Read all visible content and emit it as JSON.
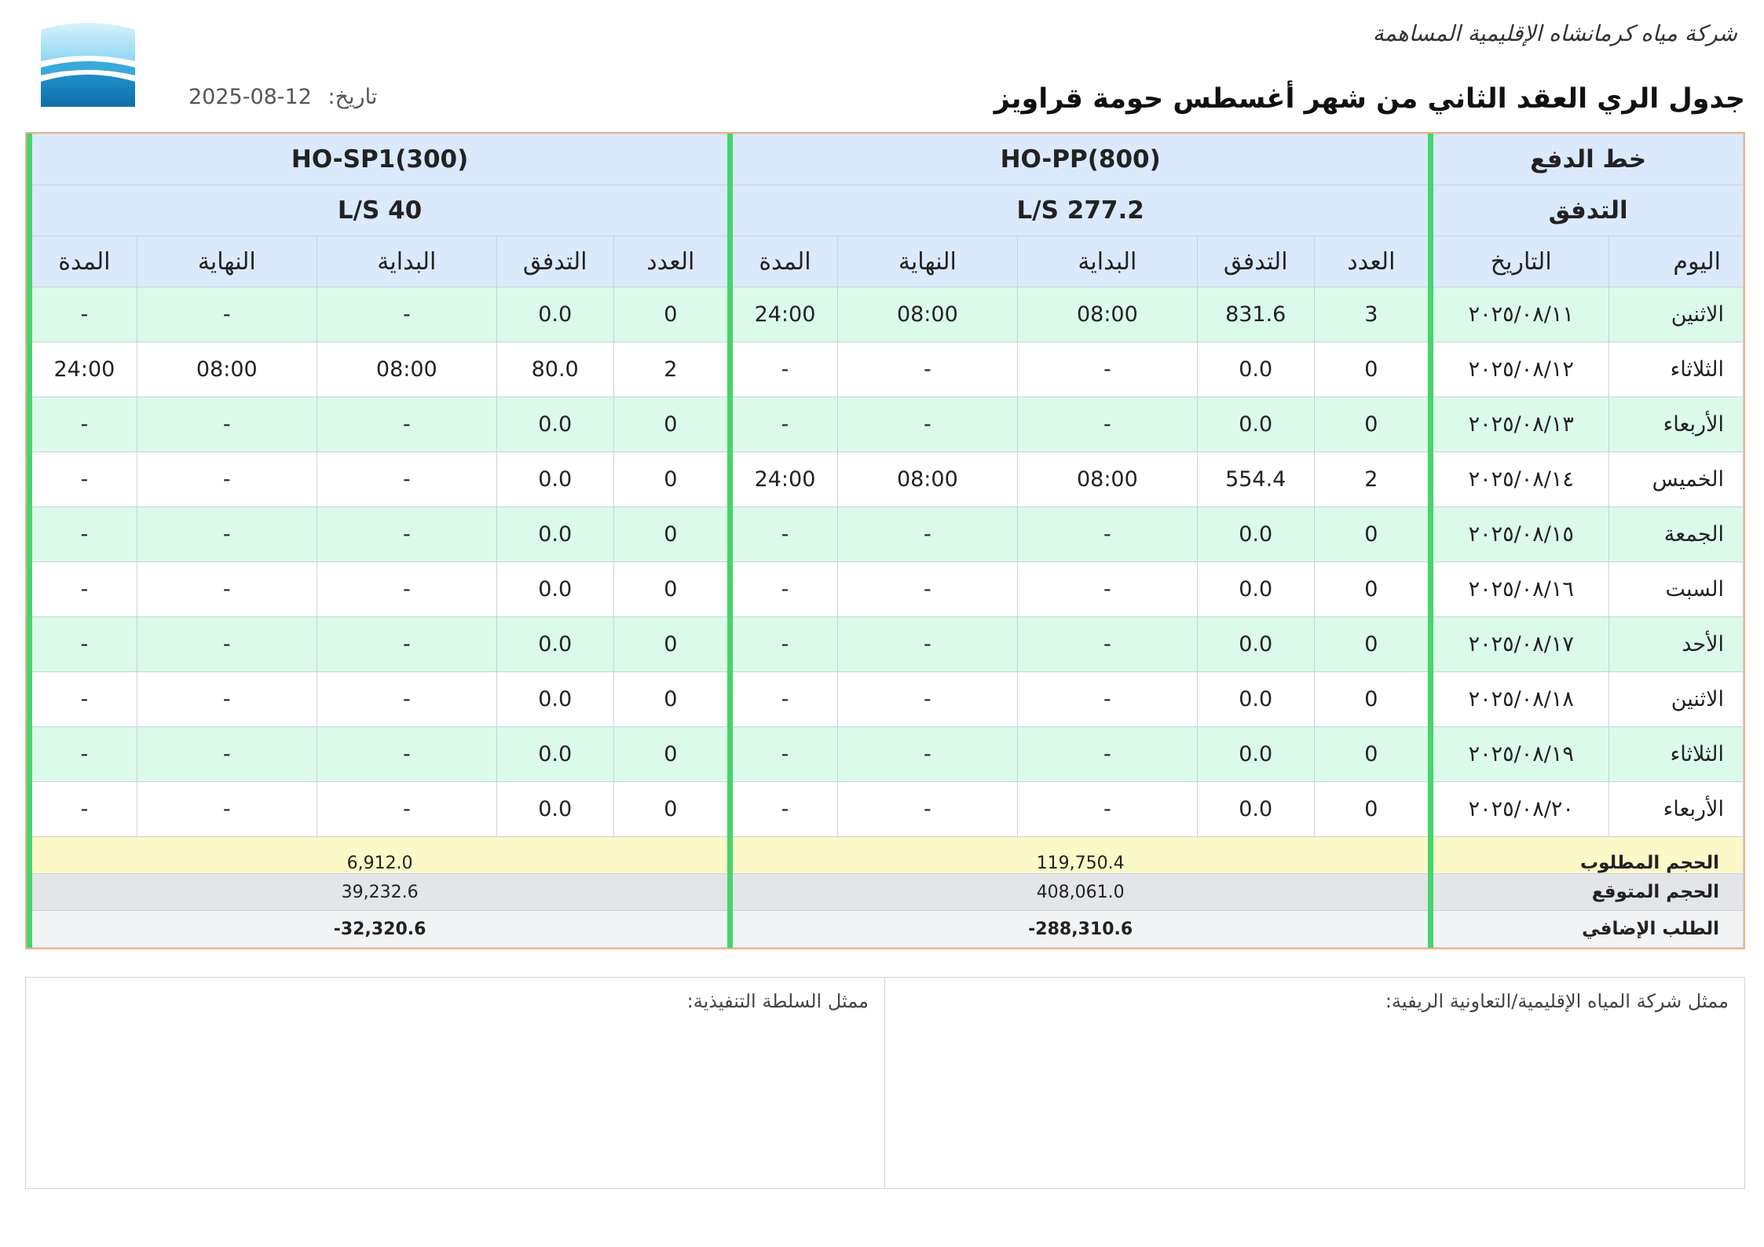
{
  "header": {
    "company_name": "شركة مياه كرمانشاه الإقليمية المساهمة",
    "title": "جدول الري العقد الثاني من شهر أغسطس حومة قراويز",
    "date_label": "تاريخ:",
    "date_value": "2025-08-12",
    "logo_icon": "water-drop-logo-icon"
  },
  "table": {
    "line_label": "خط الدفع",
    "flow_label": "التدفق",
    "day_col": "اليوم",
    "date_col": "التاريخ",
    "groups": [
      {
        "name": "HO-PP(800)",
        "flow": "277.2 L/S",
        "cols": {
          "count": "العدد",
          "flow": "التدفق",
          "start": "البداية",
          "end": "النهاية",
          "duration": "المدة"
        },
        "totals": {
          "required": "119,750.4",
          "expected": "408,061.0",
          "extra": "-288,310.6"
        }
      },
      {
        "name": "HO-SP1(300)",
        "flow": "40 L/S",
        "cols": {
          "count": "العدد",
          "flow": "التدفق",
          "start": "البداية",
          "end": "النهاية",
          "duration": "المدة"
        },
        "totals": {
          "required": "6,912.0",
          "expected": "39,232.6",
          "extra": "-32,320.6"
        }
      }
    ],
    "rows": [
      {
        "day": "الاثنين",
        "date": "٢٠٢٥/٠٨/١١",
        "g1": [
          "3",
          "831.6",
          "08:00",
          "08:00",
          "24:00"
        ],
        "g2": [
          "0",
          "0.0",
          "-",
          "-",
          "-"
        ]
      },
      {
        "day": "الثلاثاء",
        "date": "٢٠٢٥/٠٨/١٢",
        "g1": [
          "0",
          "0.0",
          "-",
          "-",
          "-"
        ],
        "g2": [
          "2",
          "80.0",
          "08:00",
          "08:00",
          "24:00"
        ]
      },
      {
        "day": "الأربعاء",
        "date": "٢٠٢٥/٠٨/١٣",
        "g1": [
          "0",
          "0.0",
          "-",
          "-",
          "-"
        ],
        "g2": [
          "0",
          "0.0",
          "-",
          "-",
          "-"
        ]
      },
      {
        "day": "الخميس",
        "date": "٢٠٢٥/٠٨/١٤",
        "g1": [
          "2",
          "554.4",
          "08:00",
          "08:00",
          "24:00"
        ],
        "g2": [
          "0",
          "0.0",
          "-",
          "-",
          "-"
        ]
      },
      {
        "day": "الجمعة",
        "date": "٢٠٢٥/٠٨/١٥",
        "g1": [
          "0",
          "0.0",
          "-",
          "-",
          "-"
        ],
        "g2": [
          "0",
          "0.0",
          "-",
          "-",
          "-"
        ]
      },
      {
        "day": "السبت",
        "date": "٢٠٢٥/٠٨/١٦",
        "g1": [
          "0",
          "0.0",
          "-",
          "-",
          "-"
        ],
        "g2": [
          "0",
          "0.0",
          "-",
          "-",
          "-"
        ]
      },
      {
        "day": "الأحد",
        "date": "٢٠٢٥/٠٨/١٧",
        "g1": [
          "0",
          "0.0",
          "-",
          "-",
          "-"
        ],
        "g2": [
          "0",
          "0.0",
          "-",
          "-",
          "-"
        ]
      },
      {
        "day": "الاثنين",
        "date": "٢٠٢٥/٠٨/١٨",
        "g1": [
          "0",
          "0.0",
          "-",
          "-",
          "-"
        ],
        "g2": [
          "0",
          "0.0",
          "-",
          "-",
          "-"
        ]
      },
      {
        "day": "الثلاثاء",
        "date": "٢٠٢٥/٠٨/١٩",
        "g1": [
          "0",
          "0.0",
          "-",
          "-",
          "-"
        ],
        "g2": [
          "0",
          "0.0",
          "-",
          "-",
          "-"
        ]
      },
      {
        "day": "الأربعاء",
        "date": "٢٠٢٥/٠٨/٢٠",
        "g1": [
          "0",
          "0.0",
          "-",
          "-",
          "-"
        ],
        "g2": [
          "0",
          "0.0",
          "-",
          "-",
          "-"
        ]
      }
    ],
    "totals_labels": {
      "required": "الحجم المطلوب",
      "expected": "الحجم المتوقع",
      "extra": "الطلب الإضافي"
    }
  },
  "signatures": {
    "left_label": "ممثل شركة المياه الإقليمية/التعاونية الريفية:",
    "right_label": "ممثل السلطة التنفيذية:"
  },
  "colors": {
    "header_bg": "#dbe9fd",
    "row_green": "#dcfaea",
    "group_separator": "#46d46c",
    "required_bg": "#fdf8c8",
    "expected_bg": "#e3e5e8",
    "border_accent": "#f0b48a"
  }
}
